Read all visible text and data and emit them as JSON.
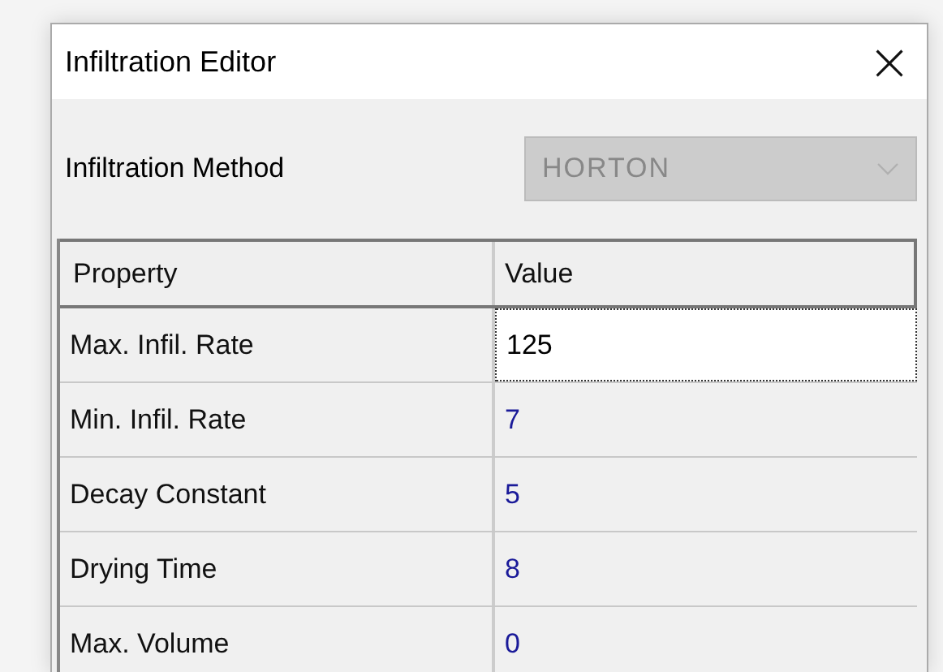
{
  "window": {
    "title": "Infiltration Editor",
    "close": "×"
  },
  "method": {
    "label": "Infiltration Method",
    "value": "HORTON",
    "disabled": true
  },
  "table": {
    "columns": [
      "Property",
      "Value"
    ],
    "rows": [
      {
        "property": "Max. Infil. Rate",
        "value": "125",
        "selected": true
      },
      {
        "property": "Min. Infil. Rate",
        "value": "7",
        "selected": false
      },
      {
        "property": "Decay Constant",
        "value": "5",
        "selected": false
      },
      {
        "property": "Drying Time",
        "value": "8",
        "selected": false
      },
      {
        "property": "Max. Volume",
        "value": "0",
        "selected": false
      }
    ]
  }
}
